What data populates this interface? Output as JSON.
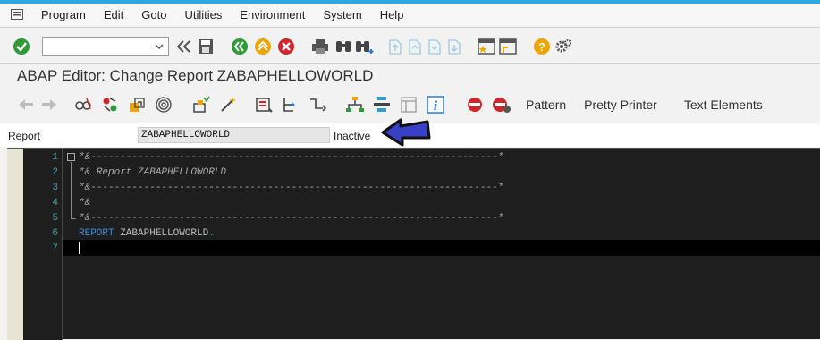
{
  "menubar": {
    "items": [
      "Program",
      "Edit",
      "Goto",
      "Utilities",
      "Environment",
      "System",
      "Help"
    ]
  },
  "command_field": {
    "value": ""
  },
  "title": "ABAP Editor: Change Report ZABAPHELLOWORLD",
  "toolbar2": {
    "pattern_label": "Pattern",
    "pretty_printer_label": "Pretty Printer",
    "text_elements_label": "Text Elements"
  },
  "report_field": {
    "label": "Report",
    "value": "ZABAPHELLOWORLD",
    "status": "Inactive"
  },
  "editor": {
    "line_numbers": [
      "1",
      "2",
      "3",
      "4",
      "5",
      "6",
      "7"
    ],
    "lines": [
      "*&---------------------------------------------------------------------*",
      "*& Report ZABAPHELLOWORLD",
      "*&---------------------------------------------------------------------*",
      "*&",
      "*&---------------------------------------------------------------------*",
      "",
      ""
    ],
    "line6_keyword": "REPORT",
    "line6_rest": " ZABAPHELLOWORLD",
    "line6_dot": "."
  },
  "colors": {
    "accent": "#2aa8e0",
    "editor_bg": "#1e1e1e",
    "keyword": "#3c8fe0",
    "line_number": "#3aa6a6",
    "arrow": "#3a3fc8"
  },
  "icons": {
    "toolbar1": [
      "enter-check-icon",
      "back-icon",
      "save-icon",
      "back-green-icon",
      "exit-icon",
      "cancel-icon",
      "print-icon",
      "find-icon",
      "find-next-icon",
      "first-page-icon",
      "prev-page-icon",
      "next-page-icon",
      "last-page-icon",
      "create-session-icon",
      "shortcut-icon",
      "help-icon",
      "settings-gear-icon"
    ],
    "toolbar2": [
      "back-arrow-icon",
      "forward-arrow-icon",
      "display-change-icon",
      "other-object-icon",
      "active-inactive-icon",
      "where-used-icon",
      "check-icon",
      "activate-icon",
      "test-icon",
      "object-list-icon",
      "navigation-window-icon",
      "enhancement-icon",
      "help-on-icon",
      "info-icon",
      "breakpoint-set-icon",
      "external-breakpoint-icon"
    ]
  }
}
